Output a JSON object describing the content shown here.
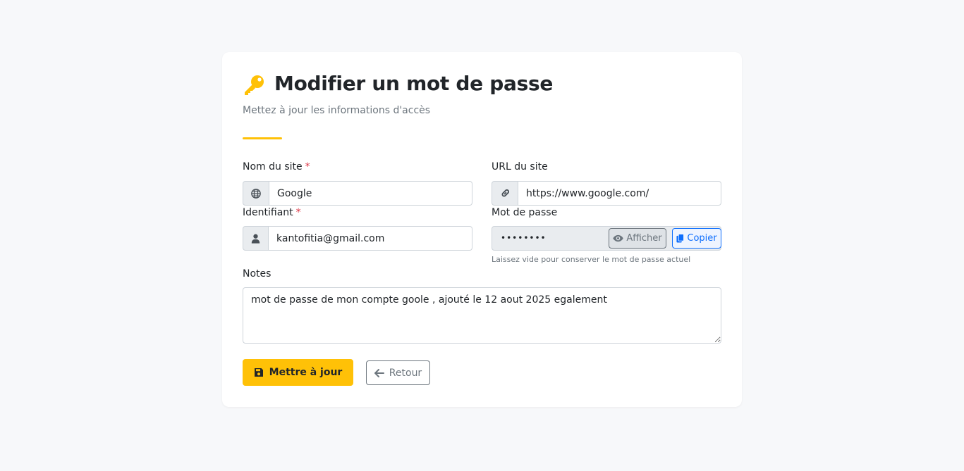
{
  "header": {
    "title": "Modifier un mot de passe",
    "subtitle": "Mettez à jour les informations d'accès",
    "accent_color": "#ffc107",
    "icon": "key-icon"
  },
  "form": {
    "site_name": {
      "label": "Nom du site",
      "required_mark": "*",
      "value": "Google",
      "icon": "globe-icon"
    },
    "site_url": {
      "label": "URL du site",
      "value": "https://www.google.com/",
      "icon": "link-icon"
    },
    "username": {
      "label": "Identifiant",
      "required_mark": "*",
      "value": "kantofitia@gmail.com",
      "icon": "user-icon"
    },
    "password": {
      "label": "Mot de passe",
      "masked_value": "••••••••",
      "show_label": "Afficher",
      "copy_label": "Copier",
      "help": "Laissez vide pour conserver le mot de passe actuel"
    },
    "notes": {
      "label": "Notes",
      "value": "mot de passe de mon compte goole , ajouté le 12 aout 2025 egalement"
    }
  },
  "actions": {
    "update_label": "Mettre à jour",
    "back_label": "Retour"
  }
}
